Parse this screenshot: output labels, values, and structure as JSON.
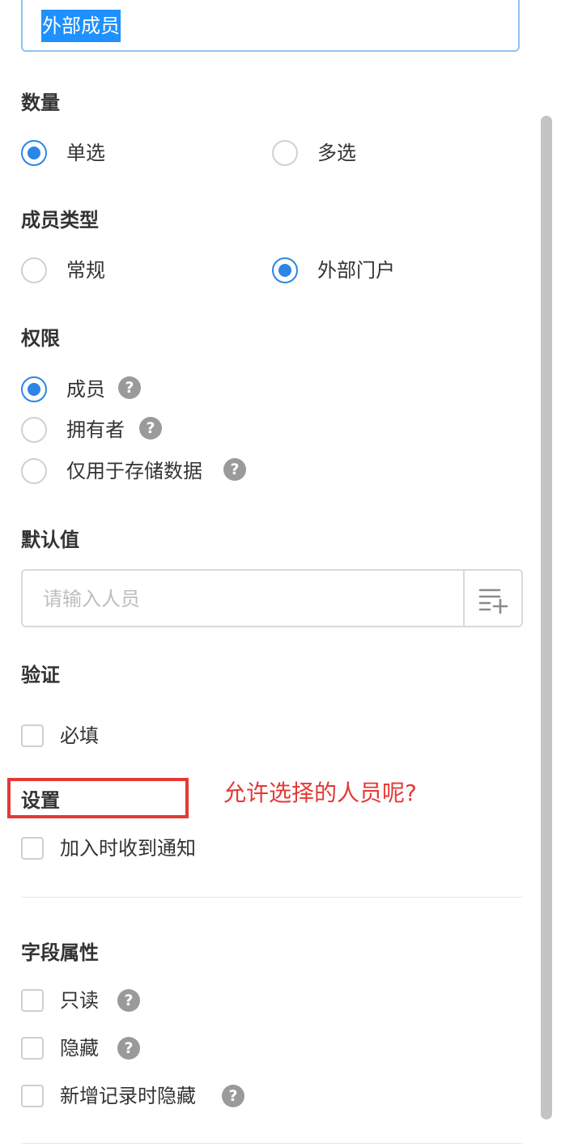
{
  "name_field": {
    "value": "外部成员"
  },
  "quantity": {
    "title": "数量",
    "options": [
      {
        "label": "单选",
        "checked": true
      },
      {
        "label": "多选",
        "checked": false
      }
    ]
  },
  "member_type": {
    "title": "成员类型",
    "options": [
      {
        "label": "常规",
        "checked": false
      },
      {
        "label": "外部门户",
        "checked": true
      }
    ]
  },
  "permission": {
    "title": "权限",
    "options": [
      {
        "label": "成员",
        "checked": true,
        "help": "?"
      },
      {
        "label": "拥有者",
        "checked": false,
        "help": "?"
      },
      {
        "label": "仅用于存储数据",
        "checked": false,
        "help": "?"
      }
    ]
  },
  "default_value": {
    "title": "默认值",
    "placeholder": "请输入人员",
    "button_icon": "list-add-icon"
  },
  "validation": {
    "title": "验证",
    "required_label": "必填",
    "required_checked": false
  },
  "settings": {
    "title": "设置",
    "notify_label": "加入时收到通知",
    "notify_checked": false
  },
  "annotation": {
    "text": "允许选择的人员呢?",
    "color": "#e53935"
  },
  "field_props": {
    "title": "字段属性",
    "items": [
      {
        "label": "只读",
        "checked": false,
        "help": "?"
      },
      {
        "label": "隐藏",
        "checked": false,
        "help": "?"
      },
      {
        "label": "新增记录时隐藏",
        "checked": false,
        "help": "?"
      }
    ]
  },
  "colors": {
    "accent": "#2b86e6",
    "selection": "#1e90ff"
  }
}
